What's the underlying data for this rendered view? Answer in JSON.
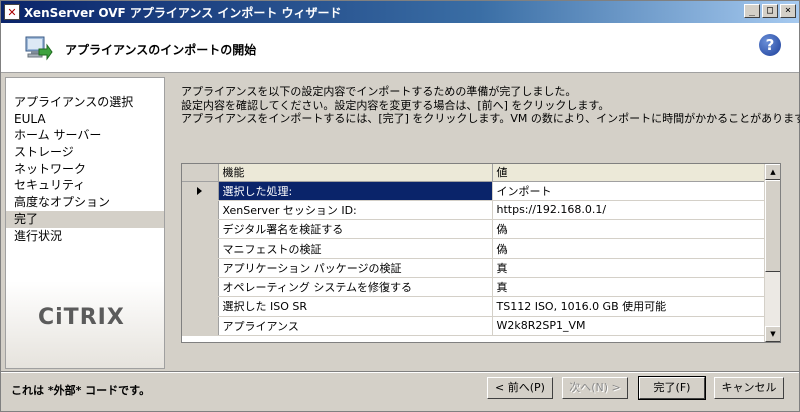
{
  "window": {
    "title": "XenServer OVF アプライアンス インポート ウィザード",
    "buttons": {
      "minimize": "_",
      "maximize": "□",
      "close": "×"
    }
  },
  "header": {
    "title": "アプライアンスのインポートの開始",
    "help_label": "?"
  },
  "nav": {
    "items": [
      {
        "label": "アプライアンスの選択",
        "active": false
      },
      {
        "label": "EULA",
        "active": false
      },
      {
        "label": "ホーム サーバー",
        "active": false
      },
      {
        "label": "ストレージ",
        "active": false
      },
      {
        "label": "ネットワーク",
        "active": false
      },
      {
        "label": "セキュリティ",
        "active": false
      },
      {
        "label": "高度なオプション",
        "active": false
      },
      {
        "label": "完了",
        "active": true
      },
      {
        "label": "進行状況",
        "active": false
      }
    ],
    "logo": "CiTRIX"
  },
  "content": {
    "desc_line1": "アプライアンスを以下の設定内容でインポートするための準備が完了しました。",
    "desc_line2": "設定内容を確認してください。設定内容を変更する場合は、[前へ] をクリックします。",
    "desc_line3": "アプライアンスをインポートするには、[完了] をクリックします。VM の数により、インポートに時間がかかることがあります。"
  },
  "grid": {
    "columns": {
      "key": "機能",
      "value": "値"
    },
    "rows": [
      {
        "key": "選択した処理:",
        "value": "インポート"
      },
      {
        "key": "XenServer セッション ID:",
        "value": "https://192.168.0.1/"
      },
      {
        "key": "デジタル署名を検証する",
        "value": "偽"
      },
      {
        "key": "マニフェストの検証",
        "value": "偽"
      },
      {
        "key": "アプリケーション パッケージの検証",
        "value": "真"
      },
      {
        "key": "オペレーティング システムを修復する",
        "value": "真"
      },
      {
        "key": "選択した ISO SR",
        "value": "TS112 ISO, 1016.0 GB 使用可能"
      },
      {
        "key": "アプライアンス",
        "value": "W2k8R2SP1_VM"
      }
    ],
    "selected_row": 0
  },
  "footer": {
    "status": "これは *外部* コードです。",
    "back_label": "< 前へ(P)",
    "next_label": "次へ(N) >",
    "finish_label": "完了(F)",
    "cancel_label": "キャンセル"
  }
}
